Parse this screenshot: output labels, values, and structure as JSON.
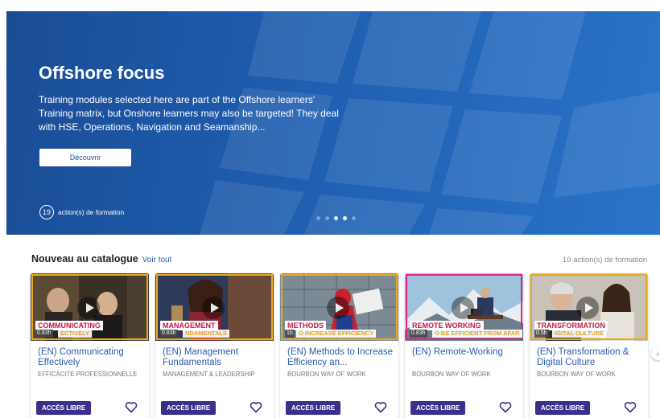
{
  "hero": {
    "title": "Offshore focus",
    "description": "Training modules selected here are part of the Offshore learners' Training matrix, but Onshore learners may also be targeted! They deal with HSE, Operations, Navigation and Seamanship...",
    "button_label": "Découvrir",
    "count": "19",
    "count_label": "action(s) de formation",
    "carousel_dots": 5,
    "active_dots": [
      2,
      3
    ]
  },
  "catalogue": {
    "title": "Nouveau au catalogue",
    "view_all": "Voir tout",
    "count_label": "10 action(s) de formation",
    "cards": [
      {
        "title": "(EN) Communicating Effectively",
        "category": "EFFICACITE PROFESSIONNELLE",
        "tag": "COMMUNICATING",
        "tag_sub": "ECTIVELY",
        "duration": "0.83h",
        "access_label": "ACCÈS LIBRE",
        "frame_color": "#e9a91c"
      },
      {
        "title": "(EN) Management Fundamentals",
        "category": "MANAGEMENT & LEADERSHIP",
        "tag": "MANAGEMENT",
        "tag_sub": "NDAMENTALS",
        "duration": "0.83h",
        "access_label": "ACCÈS LIBRE",
        "frame_color": "#e9a91c"
      },
      {
        "title": "(EN) Methods to Increase Efficiency an...",
        "category": "BOURBON WAY OF WORK",
        "tag": "METHODS",
        "tag_sub": "O INCREASE EFFICIENCY",
        "duration": "1h",
        "access_label": "ACCÈS LIBRE",
        "frame_color": "#e9a91c"
      },
      {
        "title": "(EN) Remote-Working",
        "category": "BOURBON WAY OF WORK",
        "tag": "REMOTE WORKING",
        "tag_sub": "O BE EFFICIENT FROM AFAR",
        "duration": "0.83h",
        "access_label": "ACCÈS LIBRE",
        "frame_color": "#e2258a"
      },
      {
        "title": "(EN) Transformation & Digital Culture",
        "category": "BOURBON WAY OF WORK",
        "tag": "TRANSFORMATION",
        "tag_sub": "IGITAL CULTURE",
        "duration": "0.5h",
        "access_label": "ACCÈS LIBRE",
        "frame_color": "#e9a91c"
      }
    ]
  },
  "icons": {
    "heart": "heart-outline-icon",
    "play": "play-icon",
    "next": "chevron-right-icon"
  },
  "colors": {
    "hero_bg": "#1f5eb0",
    "link": "#2a5dad",
    "access_button": "#3b2f8c",
    "tag_text": "#c6174d"
  }
}
